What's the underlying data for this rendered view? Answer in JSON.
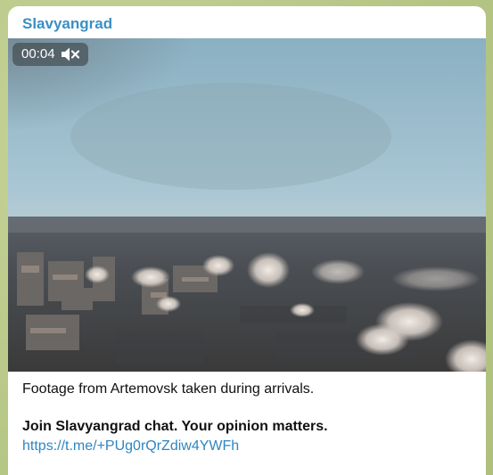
{
  "post": {
    "channel_name": "Slavyangrad",
    "video": {
      "duration_label": "00:04",
      "sound": "muted",
      "mute_icon": "speaker-muted-icon"
    },
    "caption": {
      "line1": "Footage from Artemovsk taken during arrivals.",
      "line2": "Join Slavyangrad chat. Your opinion matters.",
      "link": "https://t.me/+PUg0rQrZdiw4YWFh"
    }
  },
  "colors": {
    "channel_name": "#3a8fc4",
    "link": "#2e86c1",
    "background": "#b9c98a"
  }
}
